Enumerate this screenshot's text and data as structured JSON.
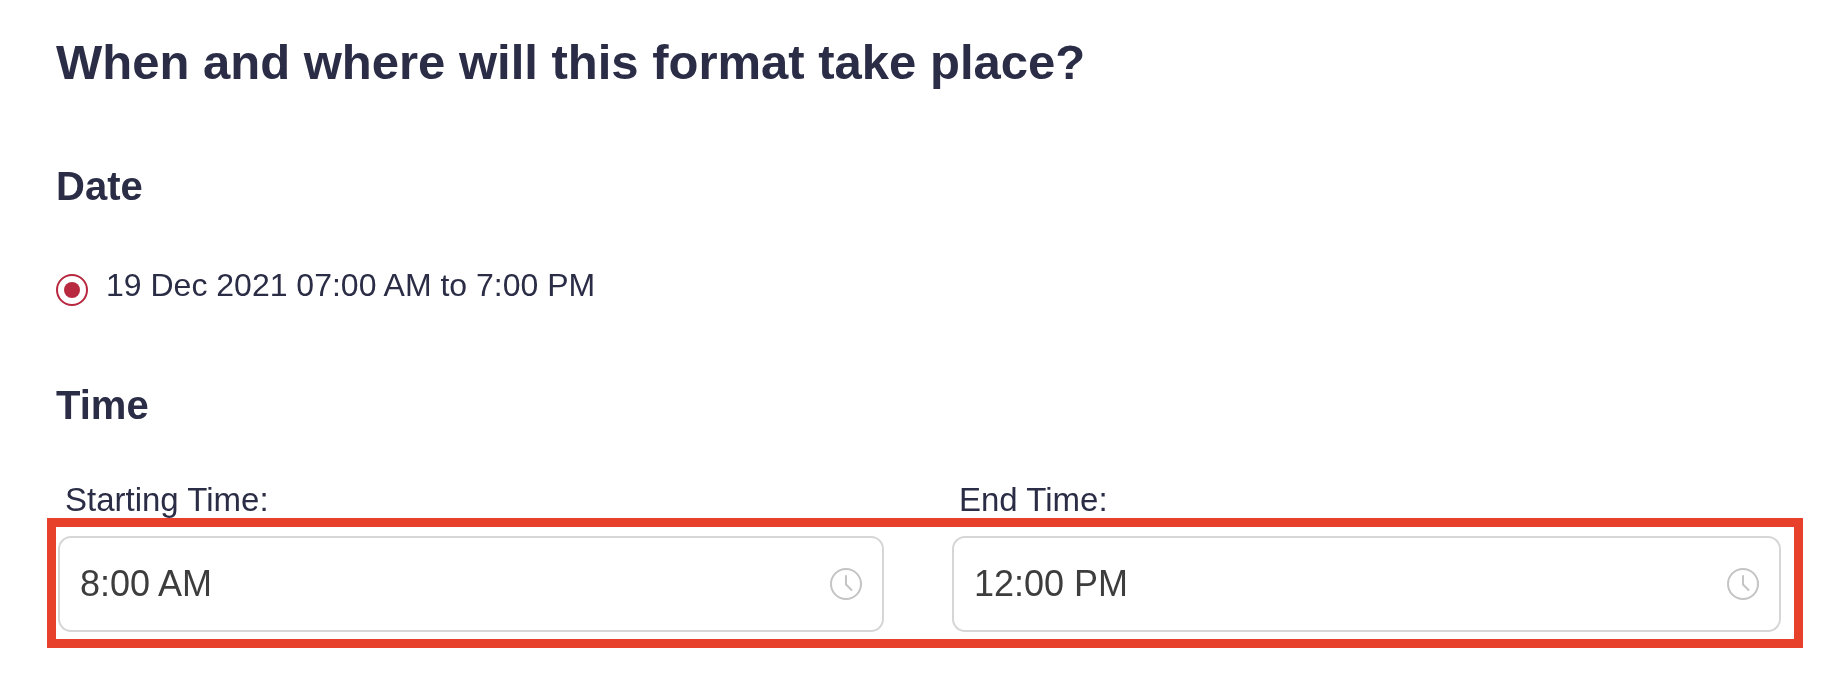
{
  "title": "When and where will this format take place?",
  "date": {
    "heading": "Date",
    "options": [
      {
        "label": "19 Dec 2021 07:00 AM to 7:00 PM",
        "selected": true
      }
    ]
  },
  "time": {
    "heading": "Time",
    "highlighted": true,
    "fields": [
      {
        "label": "Starting Time:",
        "value": "8:00 AM"
      },
      {
        "label": "End Time:",
        "value": "12:00 PM"
      }
    ]
  }
}
